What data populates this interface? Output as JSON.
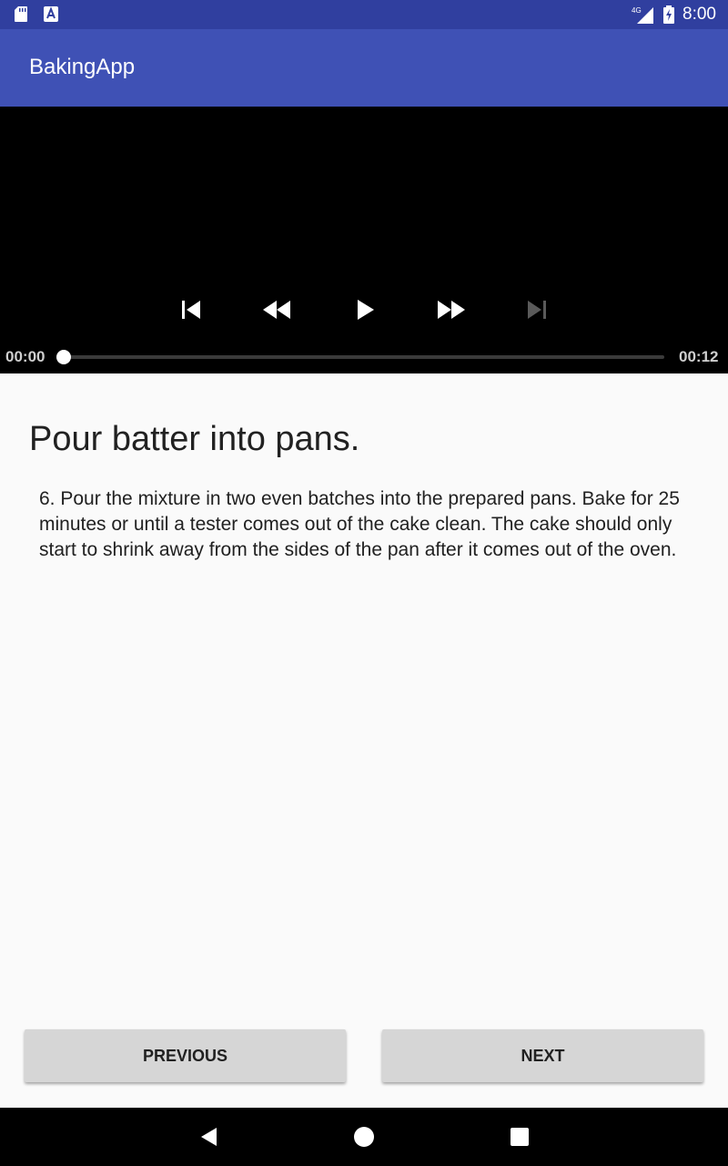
{
  "status_bar": {
    "time": "8:00",
    "network": "4G",
    "icons": [
      "sd-card-icon",
      "a-notification-icon",
      "network-signal-icon",
      "battery-charging-icon"
    ]
  },
  "app_bar": {
    "title": "BakingApp"
  },
  "player": {
    "controls": [
      "skip-previous-icon",
      "rewind-icon",
      "play-icon",
      "fast-forward-icon",
      "skip-next-icon"
    ],
    "position": "00:00",
    "duration": "00:12",
    "progress": 0.0
  },
  "step": {
    "title": "Pour batter into pans.",
    "description": "6. Pour the mixture in two even batches into the prepared pans. Bake for 25 minutes or until a tester comes out of the cake clean. The cake should only start to shrink away from the sides of the pan after it comes out of the oven."
  },
  "buttons": {
    "previous": "PREVIOUS",
    "next": "NEXT"
  },
  "nav_bar": {
    "icons": [
      "back-icon",
      "home-icon",
      "recents-icon"
    ]
  },
  "colors": {
    "status_bar": "#303f9f",
    "app_bar": "#3f51b5",
    "player_bg": "#000000",
    "button_bg": "#d6d6d6"
  }
}
